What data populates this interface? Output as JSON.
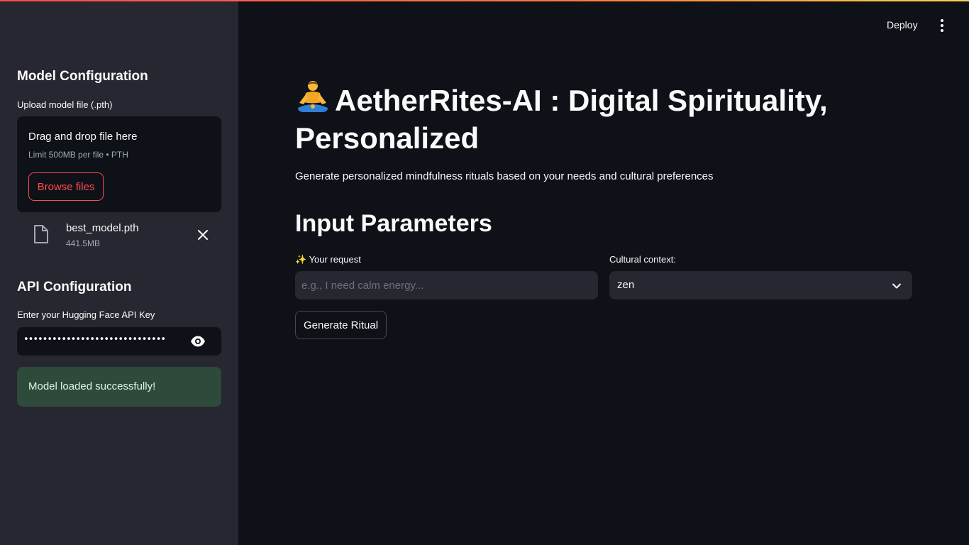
{
  "sidebar": {
    "model_config_heading": "Model Configuration",
    "upload_label": "Upload model file (.pth)",
    "dropzone": {
      "title": "Drag and drop file here",
      "limit": "Limit 500MB per file • PTH",
      "browse_label": "Browse files"
    },
    "uploaded_file": {
      "name": "best_model.pth",
      "size": "441.5MB",
      "icon": "file-icon"
    },
    "api_config_heading": "API Configuration",
    "api_key_label": "Enter your Hugging Face API Key",
    "api_key_masked": "••••••••••••••••••••••••••••••••••••",
    "success_message": "Model loaded successfully!"
  },
  "header": {
    "deploy_label": "Deploy",
    "menu_icon": "kebab-menu-icon"
  },
  "main": {
    "title_emoji": "🧘",
    "title": "AetherRites-AI : Digital Spirituality, Personalized",
    "subtitle": "Generate personalized mindfulness rituals based on your needs and cultural preferences",
    "section_heading": "Input Parameters",
    "request_label": "✨ Your request",
    "request_placeholder": "e.g., I need calm energy...",
    "request_value": "",
    "cultural_label": "Cultural context:",
    "cultural_selected": "zen",
    "generate_label": "Generate Ritual"
  },
  "colors": {
    "accent": "#ff4b4b",
    "sidebar_bg": "#262730",
    "main_bg": "#0e1117",
    "success_bg": "#2d4a3a"
  }
}
